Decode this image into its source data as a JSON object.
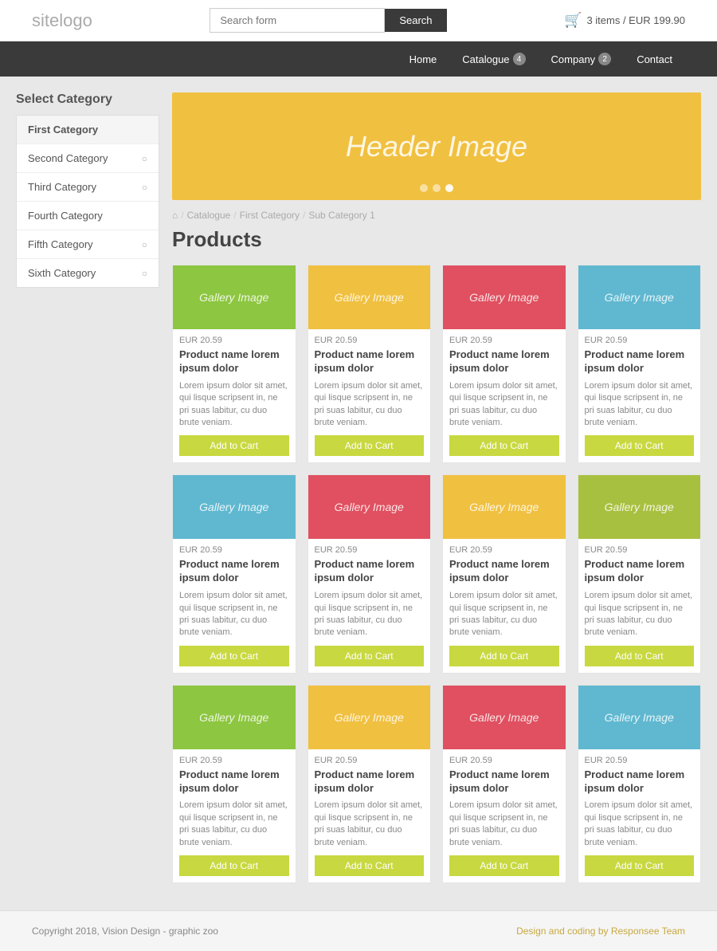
{
  "header": {
    "logo_main": "site",
    "logo_sub": "logo",
    "search_placeholder": "Search form",
    "search_button": "Search",
    "cart_icon": "🛒",
    "cart_info": "3 items / EUR 199.90"
  },
  "nav": {
    "items": [
      {
        "label": "Home",
        "badge": null
      },
      {
        "label": "Catalogue",
        "badge": "4"
      },
      {
        "label": "Company",
        "badge": "2"
      },
      {
        "label": "Contact",
        "badge": null
      }
    ]
  },
  "sidebar": {
    "title": "Select Category",
    "categories": [
      {
        "label": "First Category",
        "has_arrow": false
      },
      {
        "label": "Second Category",
        "has_arrow": true
      },
      {
        "label": "Third Category",
        "has_arrow": true
      },
      {
        "label": "Fourth Category",
        "has_arrow": false
      },
      {
        "label": "Fifth Category",
        "has_arrow": true
      },
      {
        "label": "Sixth Category",
        "has_arrow": true
      }
    ]
  },
  "banner": {
    "text": "Header Image",
    "dots": [
      false,
      false,
      true
    ]
  },
  "breadcrumb": {
    "home": "⌂",
    "items": [
      "Catalogue",
      "First Category",
      "Sub Category 1"
    ]
  },
  "products_title": "Products",
  "products": [
    {
      "color": "color-green",
      "img_label": "Gallery Image",
      "price": "EUR 20.59",
      "name": "Product name lorem ipsum dolor",
      "desc": "Lorem ipsum dolor sit amet, qui lisque scripsent in, ne pri suas labitur, cu duo brute veniam.",
      "btn": "Add to Cart"
    },
    {
      "color": "color-yellow",
      "img_label": "Gallery Image",
      "price": "EUR 20.59",
      "name": "Product name lorem ipsum dolor",
      "desc": "Lorem ipsum dolor sit amet, qui lisque scripsent in, ne pri suas labitur, cu duo brute veniam.",
      "btn": "Add to Cart"
    },
    {
      "color": "color-red",
      "img_label": "Gallery Image",
      "price": "EUR 20.59",
      "name": "Product name lorem ipsum dolor",
      "desc": "Lorem ipsum dolor sit amet, qui lisque scripsent in, ne pri suas labitur, cu duo brute veniam.",
      "btn": "Add to Cart"
    },
    {
      "color": "color-blue",
      "img_label": "Gallery Image",
      "price": "EUR 20.59",
      "name": "Product name lorem ipsum dolor",
      "desc": "Lorem ipsum dolor sit amet, qui lisque scripsent in, ne pri suas labitur, cu duo brute veniam.",
      "btn": "Add to Cart"
    },
    {
      "color": "color-blue",
      "img_label": "Gallery Image",
      "price": "EUR 20.59",
      "name": "Product name lorem ipsum dolor",
      "desc": "Lorem ipsum dolor sit amet, qui lisque scripsent in, ne pri suas labitur, cu duo brute veniam.",
      "btn": "Add to Cart"
    },
    {
      "color": "color-red",
      "img_label": "Gallery Image",
      "price": "EUR 20.59",
      "name": "Product name lorem ipsum dolor",
      "desc": "Lorem ipsum dolor sit amet, qui lisque scripsent in, ne pri suas labitur, cu duo brute veniam.",
      "btn": "Add to Cart"
    },
    {
      "color": "color-yellow",
      "img_label": "Gallery Image",
      "price": "EUR 20.59",
      "name": "Product name lorem ipsum dolor",
      "desc": "Lorem ipsum dolor sit amet, qui lisque scripsent in, ne pri suas labitur, cu duo brute veniam.",
      "btn": "Add to Cart"
    },
    {
      "color": "color-olive",
      "img_label": "Gallery Image",
      "price": "EUR 20.59",
      "name": "Product name lorem ipsum dolor",
      "desc": "Lorem ipsum dolor sit amet, qui lisque scripsent in, ne pri suas labitur, cu duo brute veniam.",
      "btn": "Add to Cart"
    },
    {
      "color": "color-green",
      "img_label": "Gallery Image",
      "price": "EUR 20.59",
      "name": "Product name lorem ipsum dolor",
      "desc": "Lorem ipsum dolor sit amet, qui lisque scripsent in, ne pri suas labitur, cu duo brute veniam.",
      "btn": "Add to Cart"
    },
    {
      "color": "color-yellow",
      "img_label": "Gallery Image",
      "price": "EUR 20.59",
      "name": "Product name lorem ipsum dolor",
      "desc": "Lorem ipsum dolor sit amet, qui lisque scripsent in, ne pri suas labitur, cu duo brute veniam.",
      "btn": "Add to Cart"
    },
    {
      "color": "color-red",
      "img_label": "Gallery Image",
      "price": "EUR 20.59",
      "name": "Product name lorem ipsum dolor",
      "desc": "Lorem ipsum dolor sit amet, qui lisque scripsent in, ne pri suas labitur, cu duo brute veniam.",
      "btn": "Add to Cart"
    },
    {
      "color": "color-blue",
      "img_label": "Gallery Image",
      "price": "EUR 20.59",
      "name": "Product name lorem ipsum dolor",
      "desc": "Lorem ipsum dolor sit amet, qui lisque scripsent in, ne pri suas labitur, cu duo brute veniam.",
      "btn": "Add to Cart"
    }
  ],
  "footer": {
    "left": "Copyright 2018, Vision Design - graphic zoo",
    "right": "Design and coding by Responsee Team"
  }
}
